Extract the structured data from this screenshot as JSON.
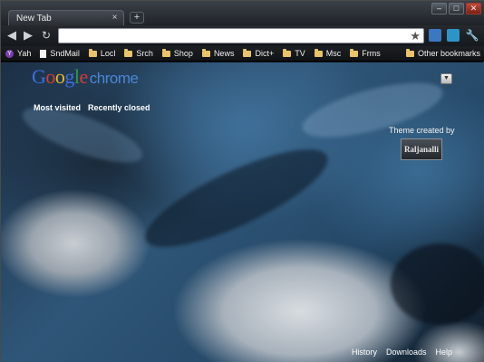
{
  "window": {
    "tab_title": "New Tab",
    "tab_close": "×",
    "new_tab": "+",
    "controls": {
      "minimize": "–",
      "maximize": "□",
      "close": "✕"
    }
  },
  "toolbar": {
    "back_icon": "back-arrow-icon",
    "forward_icon": "forward-arrow-icon",
    "url_value": "",
    "star_icon": "★"
  },
  "bookmarks": {
    "items": [
      {
        "label": "Yah",
        "icon": "yahoo-icon"
      },
      {
        "label": "SndMail",
        "icon": "page-icon"
      },
      {
        "label": "Locl",
        "icon": "folder-icon"
      },
      {
        "label": "Srch",
        "icon": "folder-icon"
      },
      {
        "label": "Shop",
        "icon": "folder-icon"
      },
      {
        "label": "News",
        "icon": "folder-icon"
      },
      {
        "label": "Dict+",
        "icon": "folder-icon"
      },
      {
        "label": "TV",
        "icon": "folder-icon"
      },
      {
        "label": "Msc",
        "icon": "folder-icon"
      },
      {
        "label": "Frms",
        "icon": "folder-icon"
      }
    ],
    "other": "Other bookmarks"
  },
  "newtab": {
    "logo_letters": [
      "G",
      "o",
      "o",
      "g",
      "l",
      "e"
    ],
    "logo_suffix": "chrome",
    "sections": [
      "Most visited",
      "Recently closed"
    ],
    "theme_credit": "Theme created by",
    "theme_author": "Raljanalli",
    "footer_links": [
      "History",
      "Downloads",
      "Help"
    ]
  },
  "colors": {
    "folder": "#e9c46a",
    "accent_blue": "#3b6ee0"
  }
}
